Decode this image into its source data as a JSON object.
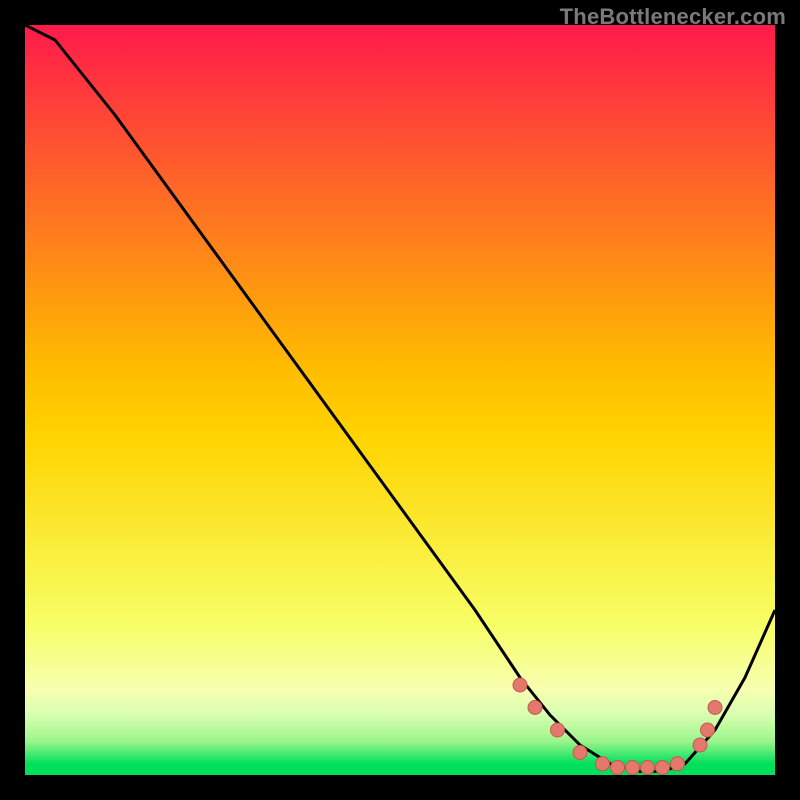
{
  "watermark": "TheBottlenecker.com",
  "colors": {
    "top": "#ff1a4b",
    "mid": "#ffd400",
    "band": "#f8ffb0",
    "bottom": "#00e05a",
    "curve": "#000000",
    "dot_fill": "#e4786c",
    "dot_stroke": "#c45a4e"
  },
  "chart_data": {
    "type": "line",
    "title": "",
    "xlabel": "",
    "ylabel": "",
    "xlim": [
      0,
      100
    ],
    "ylim": [
      0,
      100
    ],
    "x": [
      0,
      4,
      12,
      20,
      28,
      36,
      44,
      52,
      60,
      66,
      70,
      74,
      78,
      82,
      85,
      88,
      92,
      96,
      100
    ],
    "values": [
      102,
      98,
      88,
      77,
      66,
      55,
      44,
      33,
      22,
      13,
      8,
      4,
      1.5,
      0.5,
      0.5,
      1.5,
      6,
      13,
      22
    ],
    "marker_points": {
      "x": [
        66,
        68,
        71,
        74,
        77,
        79,
        81,
        83,
        85,
        87,
        90,
        91,
        92
      ],
      "y": [
        12,
        9,
        6,
        3,
        1.5,
        1,
        1,
        1,
        1,
        1.5,
        4,
        6,
        9
      ]
    }
  }
}
